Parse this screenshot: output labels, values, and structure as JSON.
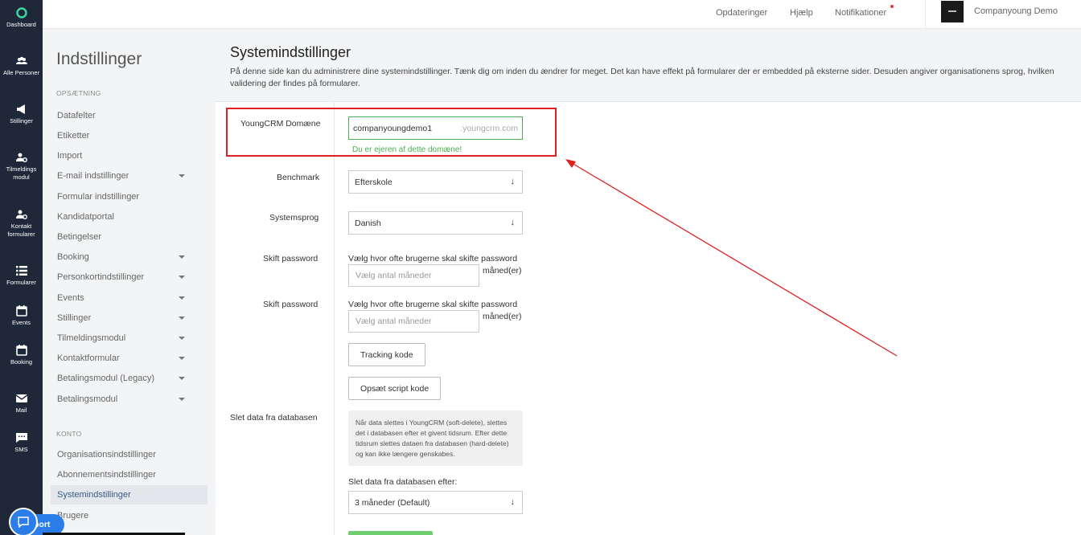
{
  "rail": [
    {
      "label": "Dashboard",
      "icon": "dashboard-icon"
    },
    {
      "label": "Alle Personer",
      "icon": "people-icon"
    },
    {
      "label": "Stillinger",
      "icon": "megaphone-icon"
    },
    {
      "label": "Tilmeldings modul",
      "icon": "person-gear-icon"
    },
    {
      "label": "Kontakt formularer",
      "icon": "person-gear-icon"
    },
    {
      "label": "Formularer",
      "icon": "list-icon"
    },
    {
      "label": "Events",
      "icon": "calendar-icon"
    },
    {
      "label": "Booking",
      "icon": "calendar-icon"
    },
    {
      "label": "Mail",
      "icon": "mail-icon"
    },
    {
      "label": "SMS",
      "icon": "chat-icon"
    }
  ],
  "topbar": {
    "updates": "Opdateringer",
    "help": "Hjælp",
    "notifications": "Notifikationer",
    "account": "Companyoung Demo"
  },
  "settings_nav": {
    "title": "Indstillinger",
    "section_setup": "OPSÆTNING",
    "setup_items": [
      {
        "label": "Datafelter",
        "caret": false
      },
      {
        "label": "Etiketter",
        "caret": false
      },
      {
        "label": "Import",
        "caret": false
      },
      {
        "label": "E-mail indstillinger",
        "caret": true
      },
      {
        "label": "Formular indstillinger",
        "caret": false
      },
      {
        "label": "Kandidatportal",
        "caret": false
      },
      {
        "label": "Betingelser",
        "caret": false
      },
      {
        "label": "Booking",
        "caret": true
      },
      {
        "label": "Personkortindstillinger",
        "caret": true
      },
      {
        "label": "Events",
        "caret": true
      },
      {
        "label": "Stillinger",
        "caret": true
      },
      {
        "label": "Tilmeldingsmodul",
        "caret": true
      },
      {
        "label": "Kontaktformular",
        "caret": true
      },
      {
        "label": "Betalingsmodul (Legacy)",
        "caret": true
      },
      {
        "label": "Betalingsmodul",
        "caret": true
      }
    ],
    "section_account": "KONTO",
    "account_items": [
      {
        "label": "Organisationsindstillinger",
        "active": false
      },
      {
        "label": "Abonnementsindstillinger",
        "active": false
      },
      {
        "label": "Systemindstillinger",
        "active": true
      },
      {
        "label": "Brugere",
        "active": false
      }
    ]
  },
  "page": {
    "title": "Systemindstillinger",
    "description": "På denne side kan du administrere dine systemindstillinger. Tænk dig om inden du ændrer for meget. Det kan have effekt på formularer der er embedded på eksterne sider. Desuden angiver organisationens sprog, hvilken validering der findes på formularer."
  },
  "form": {
    "domain_label": "YoungCRM Domæne",
    "domain_value": "companyoungdemo1",
    "domain_suffix": ".youngcrm.com",
    "domain_status": "Du er ejeren af dette domæne!",
    "benchmark_label": "Benchmark",
    "benchmark_value": "Efterskole",
    "language_label": "Systemsprog",
    "language_value": "Danish",
    "password1_label": "Skift password",
    "password1_help": "Vælg hvor ofte brugerne skal skifte password",
    "password1_placeholder": "Vælg antal måneder",
    "password1_unit": "måned(er)",
    "password2_label": "Skift password",
    "password2_help": "Vælg hvor ofte brugerne skal skifte password",
    "password2_placeholder": "Vælg antal måneder",
    "password2_unit": "måned(er)",
    "tracking_button": "Tracking kode",
    "script_button": "Opsæt script kode",
    "delete_label": "Slet data fra databasen",
    "delete_info": "Når data slettes i YoungCRM (soft-delete), slettes det i databasen efter et givent tidsrum. Efter dette tidsrum slettes dataen fra databasen (hard-delete) og kan ikke længere genskabes.",
    "delete_after_label": "Slet data fra databasen efter:",
    "delete_after_value": "3 måneder (Default)"
  },
  "support": {
    "label": "port"
  },
  "colors": {
    "rail": "#1e2838",
    "success": "#4caf50",
    "annotation": "#e02020",
    "support": "#2b7de9"
  }
}
